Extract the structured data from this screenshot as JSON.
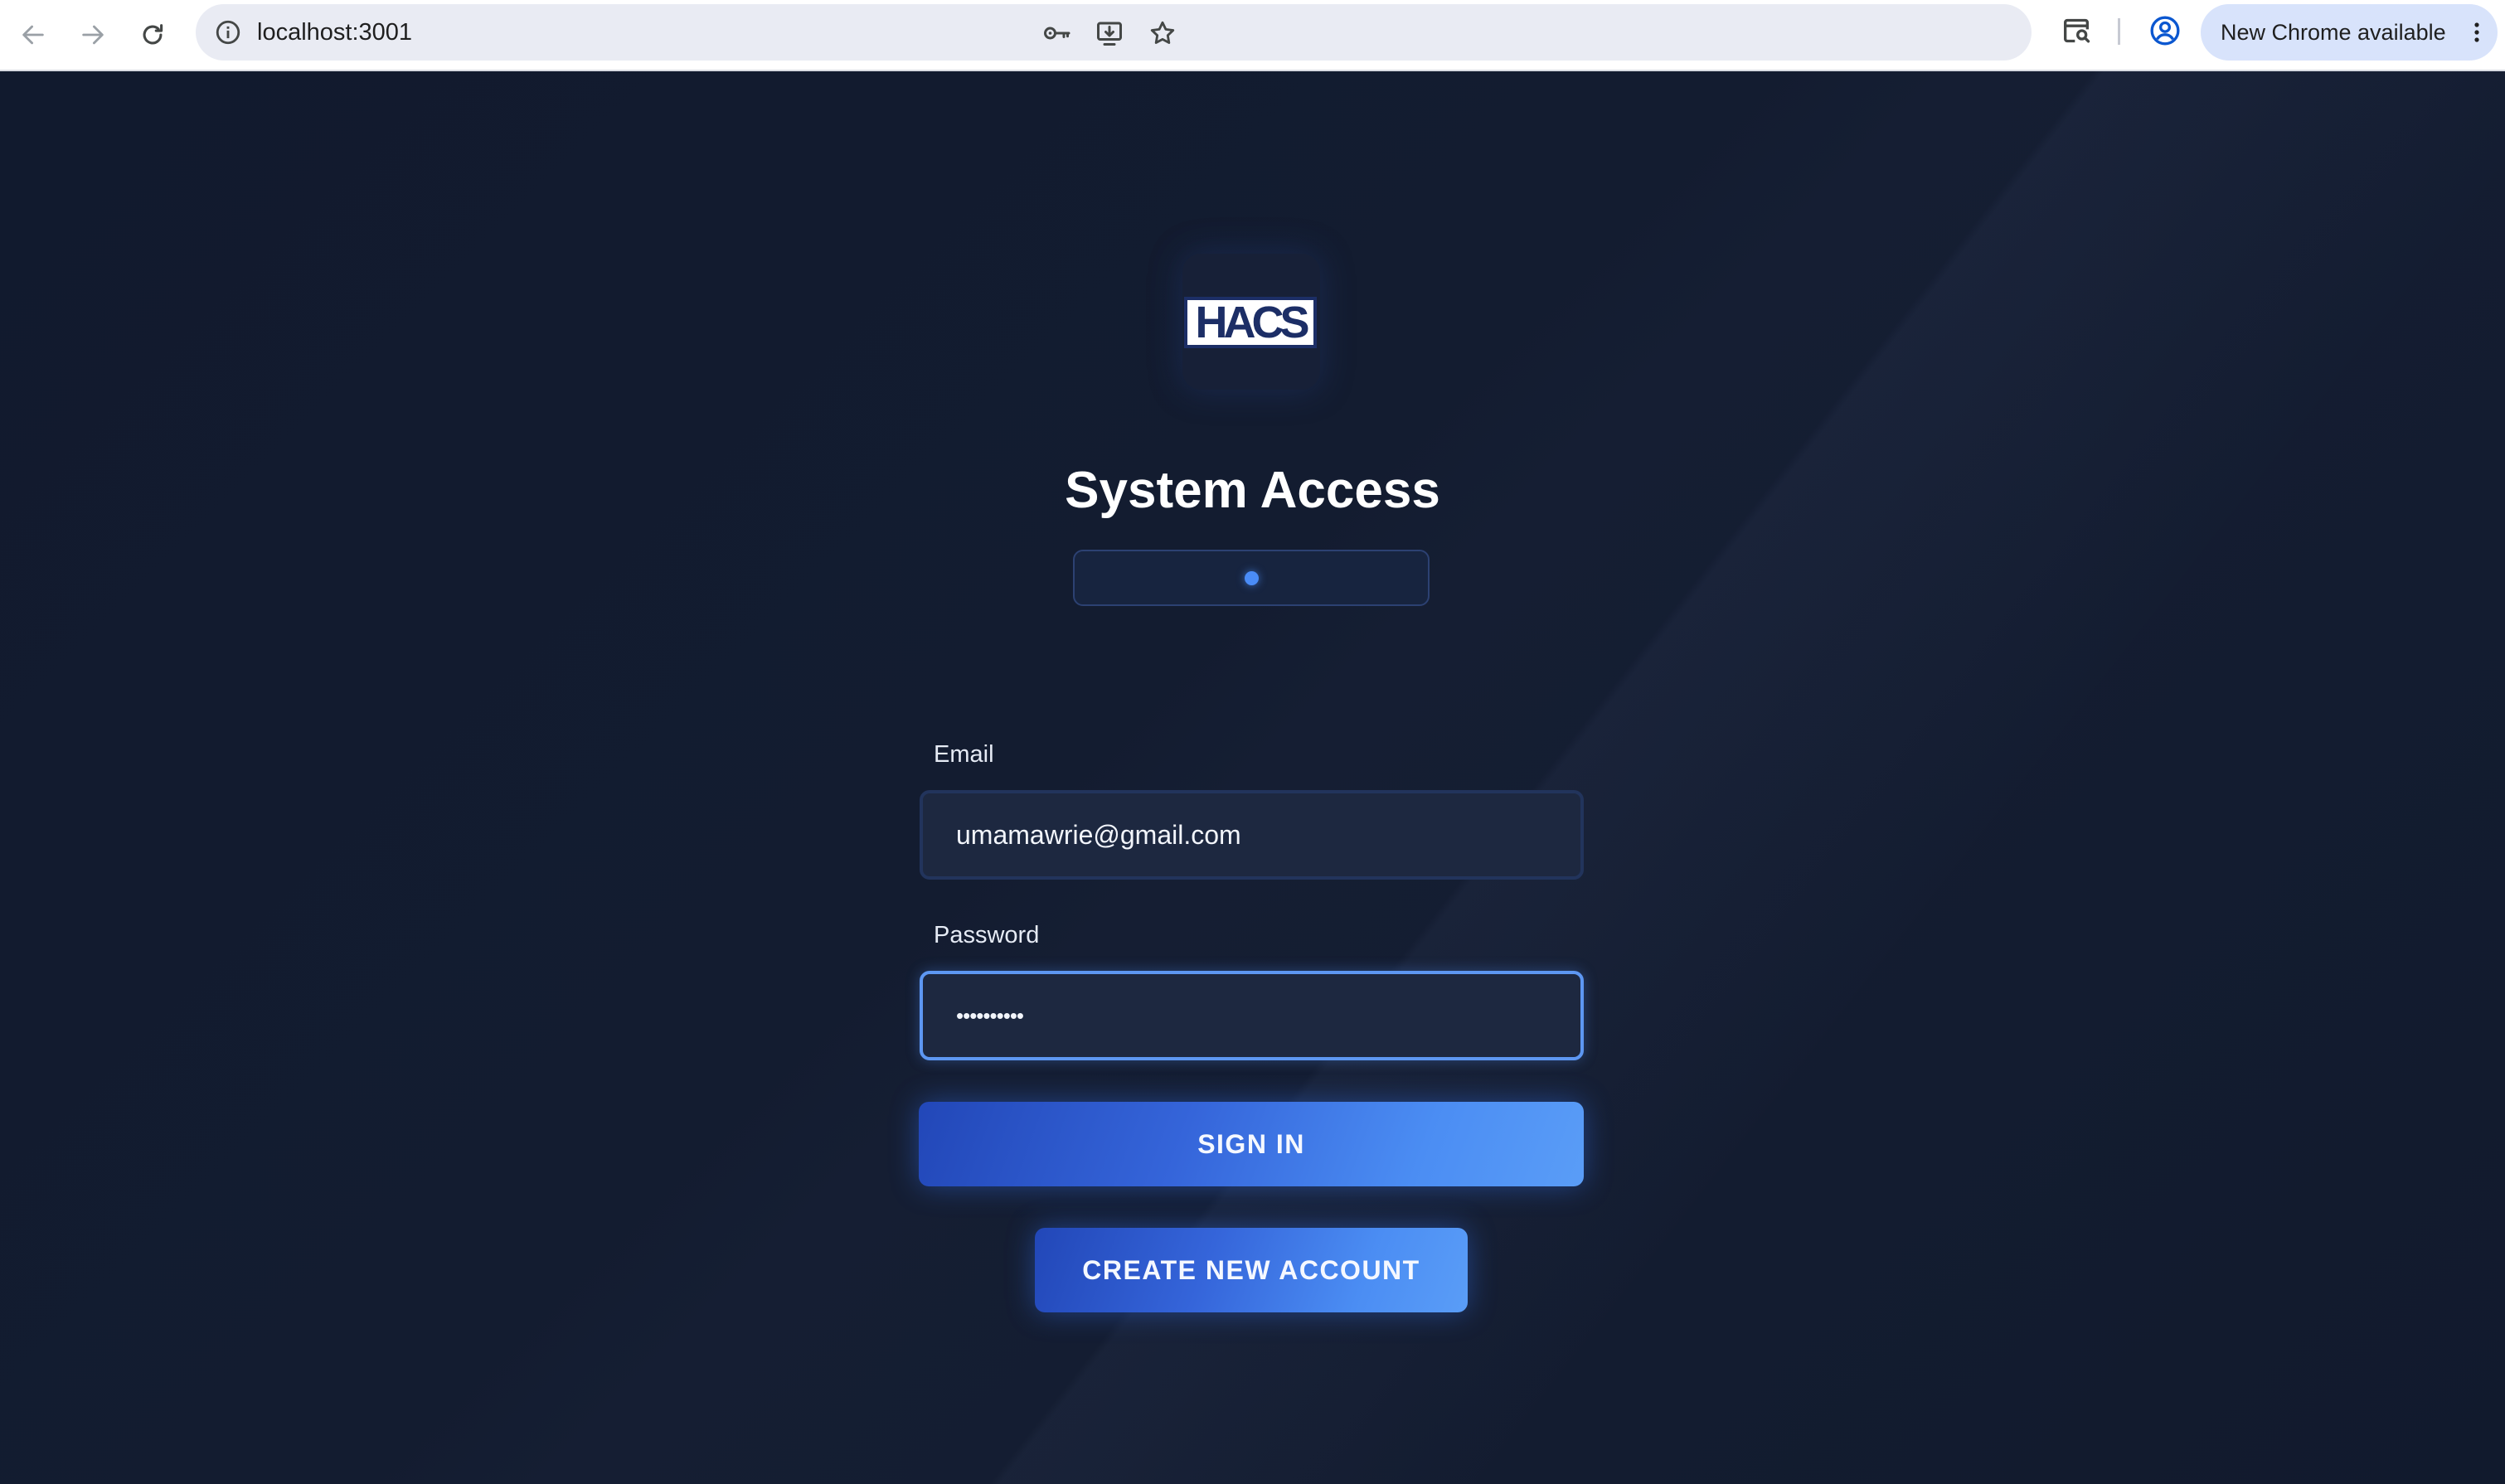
{
  "browser": {
    "url": "localhost:3001",
    "update_label": "New Chrome available"
  },
  "page": {
    "logo_text": "HACS",
    "title": "System Access",
    "email": {
      "label": "Email",
      "value": "umamawrie@gmail.com"
    },
    "password": {
      "label": "Password",
      "value": "••••••••••"
    },
    "sign_in_label": "SIGN IN",
    "create_account_label": "CREATE NEW ACCOUNT"
  },
  "colors": {
    "page_bg": "#131b2e",
    "accent": "#4a8cf7",
    "button_start": "#2247b8",
    "button_end": "#5a9df7",
    "field_bg": "#1d2840",
    "focus_border": "#5d97f2"
  },
  "icons": [
    "back-arrow-icon",
    "forward-arrow-icon",
    "reload-icon",
    "info-icon",
    "password-key-icon",
    "install-app-icon",
    "bookmark-star-icon",
    "tab-search-icon",
    "profile-icon",
    "more-vert-icon"
  ]
}
